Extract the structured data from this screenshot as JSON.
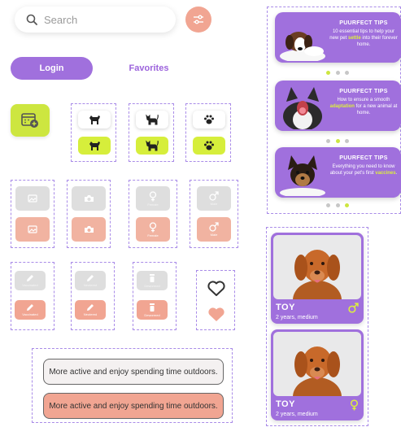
{
  "search": {
    "placeholder": "Search"
  },
  "auth_tabs": {
    "login": "Login",
    "favorites": "Favorites"
  },
  "photo_chips": {
    "camera_label": "",
    "female": "Female",
    "male": "Male"
  },
  "action_chips": {
    "vaccinated": "Vaccinated",
    "neutered": "Neutered",
    "dewormed": "Dewormed"
  },
  "options": {
    "active_1": "More active and enjoy spending time outdoors.",
    "active_2": "More active and enjoy spending time outdoors."
  },
  "tips": [
    {
      "title": "PUURFECT TIPS",
      "body_pre": "10 essential tips to help your new pet ",
      "highlight": "settle",
      "body_post": " into their forever home.",
      "active_dot": 0
    },
    {
      "title": "PUURFECT TIPS",
      "body_pre": "How to ensure a smooth ",
      "highlight": "adaptation",
      "body_post": " for a new animal at home.",
      "active_dot": 1
    },
    {
      "title": "PUURFECT TIPS",
      "body_pre": "Everything you need to know about your pet's first ",
      "highlight": "vaccines",
      "body_post": ".",
      "active_dot": 2
    }
  ],
  "pets": [
    {
      "name": "TOY",
      "info": "2 years, medium",
      "gender": "male"
    },
    {
      "name": "TOY",
      "info": "2 years, medium",
      "gender": "female"
    }
  ],
  "colors": {
    "purple": "#a070dd",
    "lime": "#cde640",
    "salmon": "#f1a592",
    "grey": "#dedede"
  },
  "icons": [
    "search-icon",
    "filter-sliders-icon",
    "calendar-add-icon",
    "dog-icon",
    "cat-icon",
    "paw-icon",
    "image-icon",
    "camera-icon",
    "female-icon",
    "male-icon",
    "pencil-icon",
    "syringe-icon",
    "heart-icon"
  ]
}
